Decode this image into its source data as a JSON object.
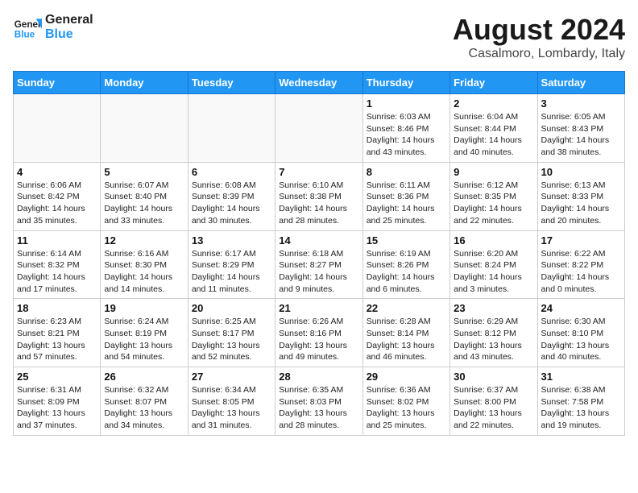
{
  "logo": {
    "line1": "General",
    "line2": "Blue"
  },
  "title": "August 2024",
  "subtitle": "Casalmoro, Lombardy, Italy",
  "weekdays": [
    "Sunday",
    "Monday",
    "Tuesday",
    "Wednesday",
    "Thursday",
    "Friday",
    "Saturday"
  ],
  "weeks": [
    [
      {
        "day": "",
        "info": ""
      },
      {
        "day": "",
        "info": ""
      },
      {
        "day": "",
        "info": ""
      },
      {
        "day": "",
        "info": ""
      },
      {
        "day": "1",
        "info": "Sunrise: 6:03 AM\nSunset: 8:46 PM\nDaylight: 14 hours\nand 43 minutes."
      },
      {
        "day": "2",
        "info": "Sunrise: 6:04 AM\nSunset: 8:44 PM\nDaylight: 14 hours\nand 40 minutes."
      },
      {
        "day": "3",
        "info": "Sunrise: 6:05 AM\nSunset: 8:43 PM\nDaylight: 14 hours\nand 38 minutes."
      }
    ],
    [
      {
        "day": "4",
        "info": "Sunrise: 6:06 AM\nSunset: 8:42 PM\nDaylight: 14 hours\nand 35 minutes."
      },
      {
        "day": "5",
        "info": "Sunrise: 6:07 AM\nSunset: 8:40 PM\nDaylight: 14 hours\nand 33 minutes."
      },
      {
        "day": "6",
        "info": "Sunrise: 6:08 AM\nSunset: 8:39 PM\nDaylight: 14 hours\nand 30 minutes."
      },
      {
        "day": "7",
        "info": "Sunrise: 6:10 AM\nSunset: 8:38 PM\nDaylight: 14 hours\nand 28 minutes."
      },
      {
        "day": "8",
        "info": "Sunrise: 6:11 AM\nSunset: 8:36 PM\nDaylight: 14 hours\nand 25 minutes."
      },
      {
        "day": "9",
        "info": "Sunrise: 6:12 AM\nSunset: 8:35 PM\nDaylight: 14 hours\nand 22 minutes."
      },
      {
        "day": "10",
        "info": "Sunrise: 6:13 AM\nSunset: 8:33 PM\nDaylight: 14 hours\nand 20 minutes."
      }
    ],
    [
      {
        "day": "11",
        "info": "Sunrise: 6:14 AM\nSunset: 8:32 PM\nDaylight: 14 hours\nand 17 minutes."
      },
      {
        "day": "12",
        "info": "Sunrise: 6:16 AM\nSunset: 8:30 PM\nDaylight: 14 hours\nand 14 minutes."
      },
      {
        "day": "13",
        "info": "Sunrise: 6:17 AM\nSunset: 8:29 PM\nDaylight: 14 hours\nand 11 minutes."
      },
      {
        "day": "14",
        "info": "Sunrise: 6:18 AM\nSunset: 8:27 PM\nDaylight: 14 hours\nand 9 minutes."
      },
      {
        "day": "15",
        "info": "Sunrise: 6:19 AM\nSunset: 8:26 PM\nDaylight: 14 hours\nand 6 minutes."
      },
      {
        "day": "16",
        "info": "Sunrise: 6:20 AM\nSunset: 8:24 PM\nDaylight: 14 hours\nand 3 minutes."
      },
      {
        "day": "17",
        "info": "Sunrise: 6:22 AM\nSunset: 8:22 PM\nDaylight: 14 hours\nand 0 minutes."
      }
    ],
    [
      {
        "day": "18",
        "info": "Sunrise: 6:23 AM\nSunset: 8:21 PM\nDaylight: 13 hours\nand 57 minutes."
      },
      {
        "day": "19",
        "info": "Sunrise: 6:24 AM\nSunset: 8:19 PM\nDaylight: 13 hours\nand 54 minutes."
      },
      {
        "day": "20",
        "info": "Sunrise: 6:25 AM\nSunset: 8:17 PM\nDaylight: 13 hours\nand 52 minutes."
      },
      {
        "day": "21",
        "info": "Sunrise: 6:26 AM\nSunset: 8:16 PM\nDaylight: 13 hours\nand 49 minutes."
      },
      {
        "day": "22",
        "info": "Sunrise: 6:28 AM\nSunset: 8:14 PM\nDaylight: 13 hours\nand 46 minutes."
      },
      {
        "day": "23",
        "info": "Sunrise: 6:29 AM\nSunset: 8:12 PM\nDaylight: 13 hours\nand 43 minutes."
      },
      {
        "day": "24",
        "info": "Sunrise: 6:30 AM\nSunset: 8:10 PM\nDaylight: 13 hours\nand 40 minutes."
      }
    ],
    [
      {
        "day": "25",
        "info": "Sunrise: 6:31 AM\nSunset: 8:09 PM\nDaylight: 13 hours\nand 37 minutes."
      },
      {
        "day": "26",
        "info": "Sunrise: 6:32 AM\nSunset: 8:07 PM\nDaylight: 13 hours\nand 34 minutes."
      },
      {
        "day": "27",
        "info": "Sunrise: 6:34 AM\nSunset: 8:05 PM\nDaylight: 13 hours\nand 31 minutes."
      },
      {
        "day": "28",
        "info": "Sunrise: 6:35 AM\nSunset: 8:03 PM\nDaylight: 13 hours\nand 28 minutes."
      },
      {
        "day": "29",
        "info": "Sunrise: 6:36 AM\nSunset: 8:02 PM\nDaylight: 13 hours\nand 25 minutes."
      },
      {
        "day": "30",
        "info": "Sunrise: 6:37 AM\nSunset: 8:00 PM\nDaylight: 13 hours\nand 22 minutes."
      },
      {
        "day": "31",
        "info": "Sunrise: 6:38 AM\nSunset: 7:58 PM\nDaylight: 13 hours\nand 19 minutes."
      }
    ]
  ]
}
